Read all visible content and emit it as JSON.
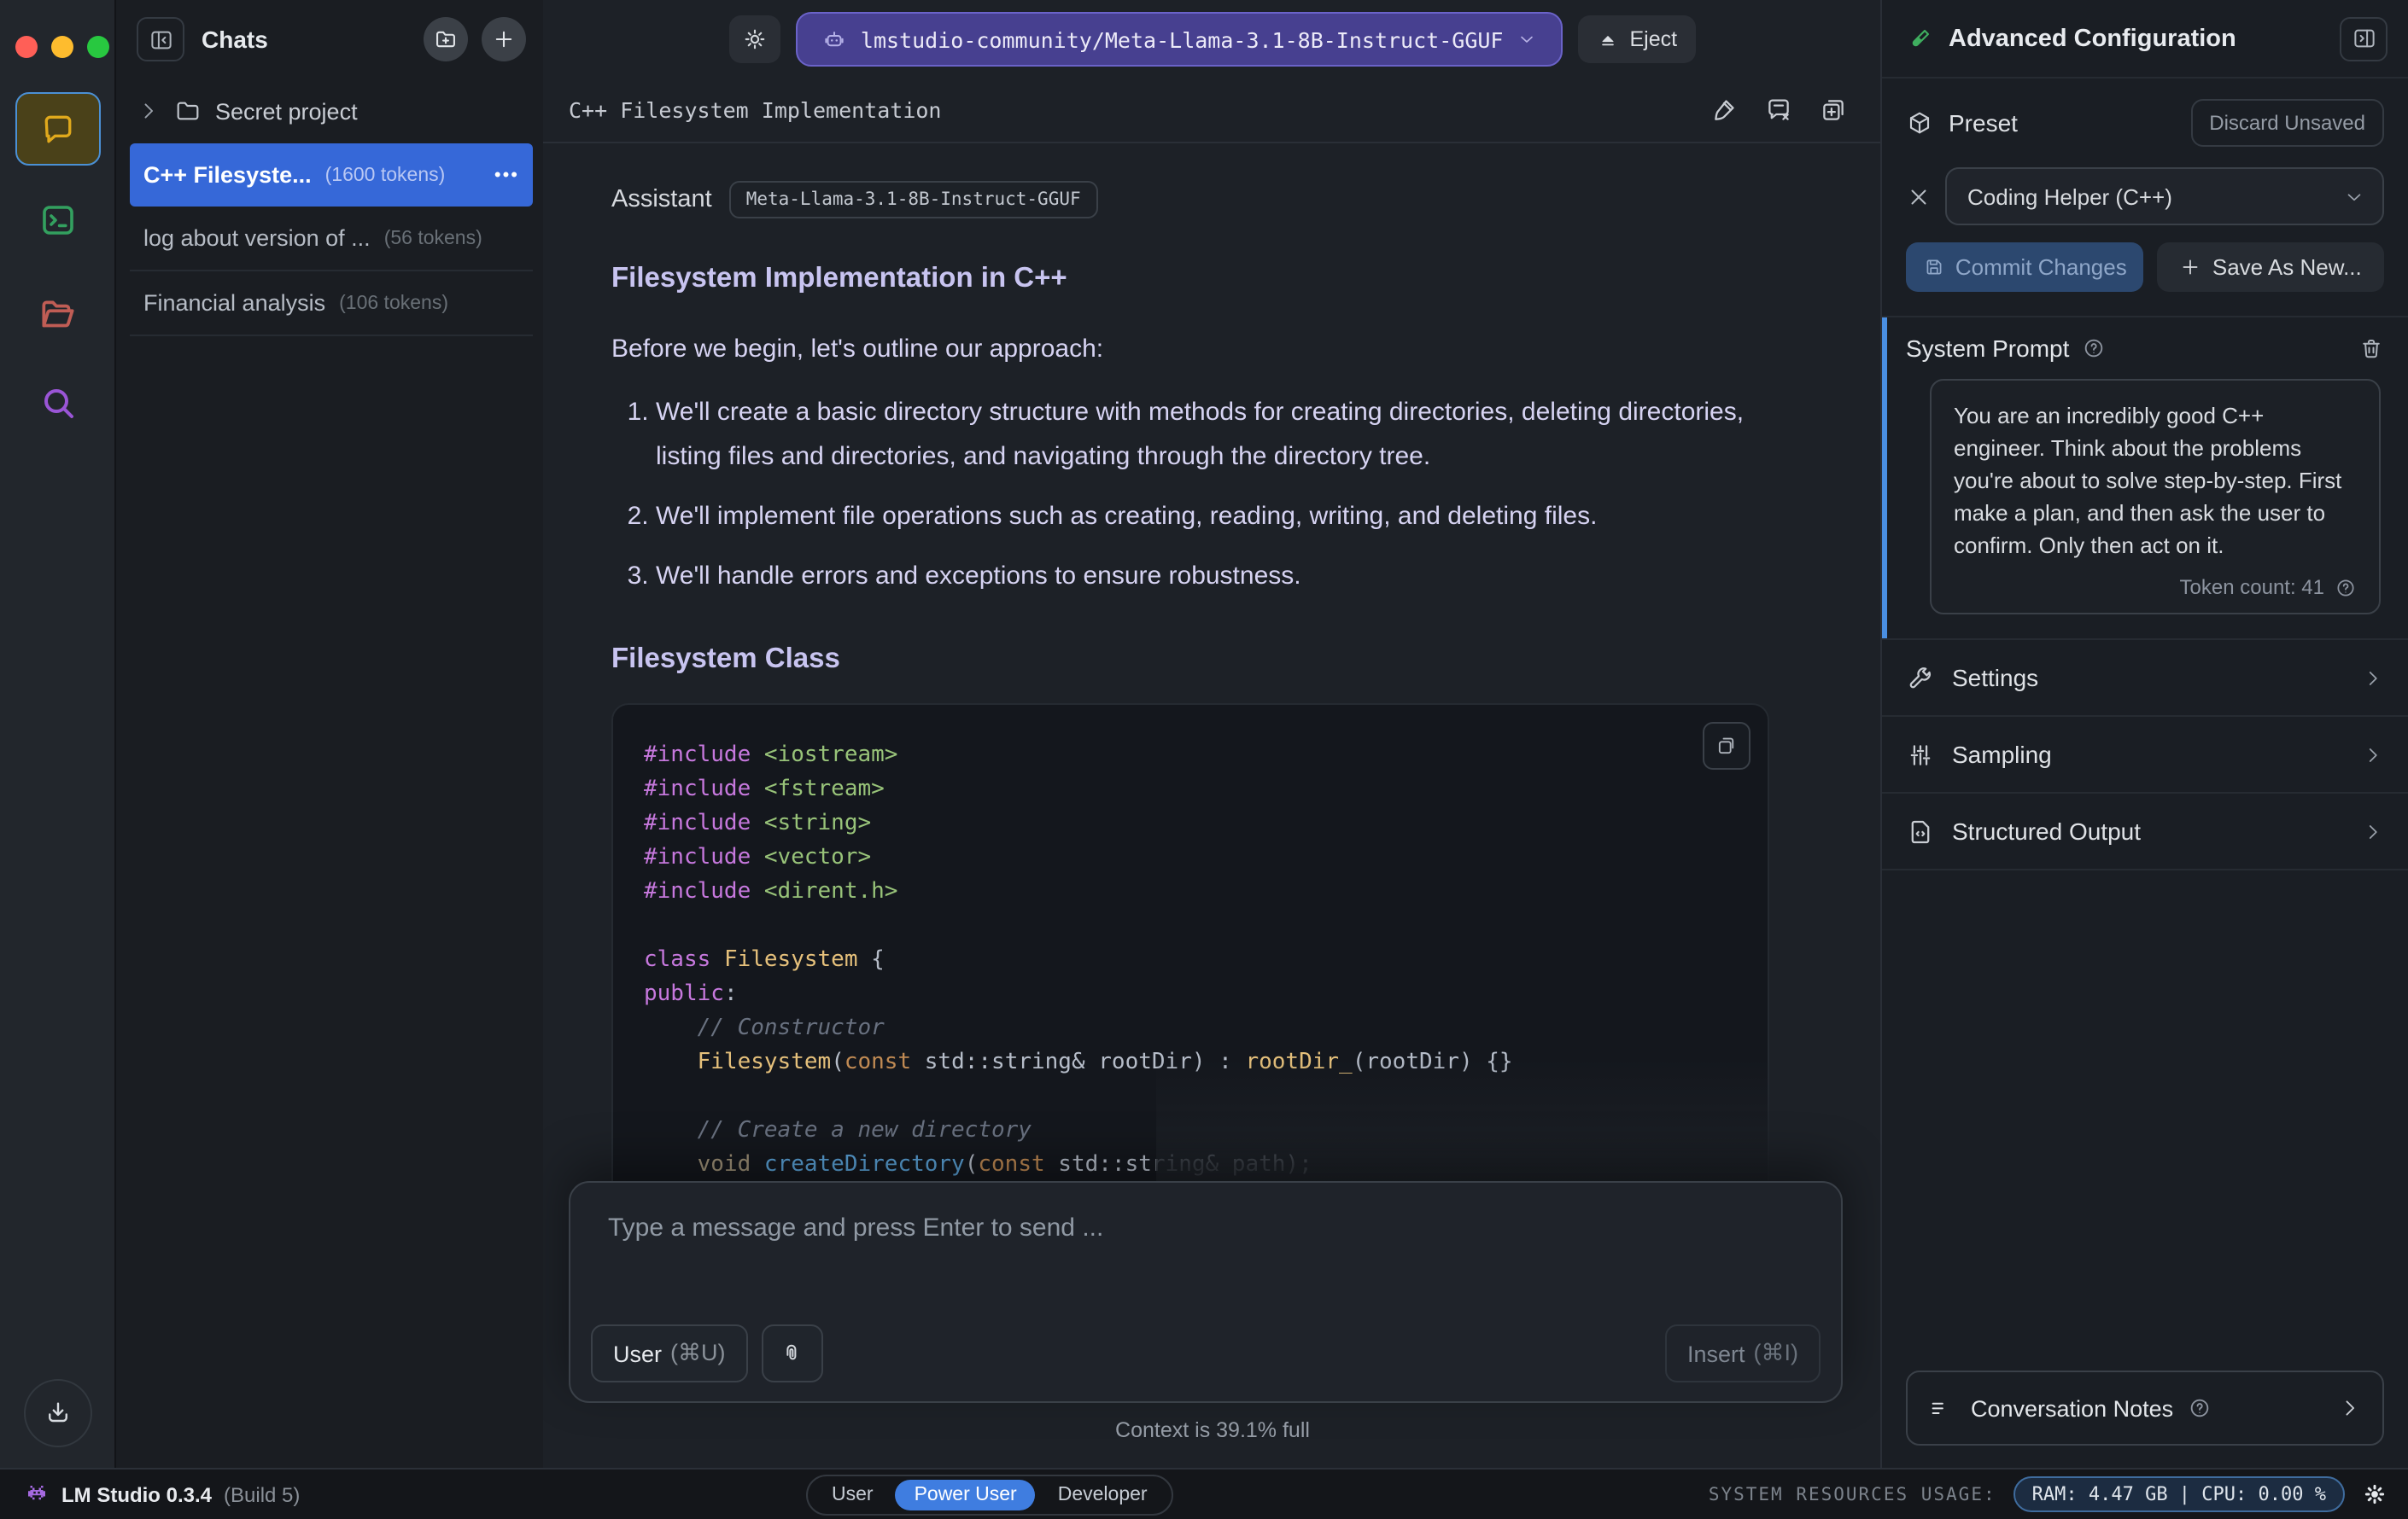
{
  "chats_panel": {
    "title": "Chats",
    "folder": {
      "name": "Secret project"
    },
    "items": [
      {
        "title": "C++ Filesyste...",
        "tokens": "(1600 tokens)",
        "selected": true,
        "menu": "•••"
      },
      {
        "title": "log about version of ...",
        "tokens": "(56 tokens)"
      },
      {
        "title": "Financial analysis",
        "tokens": "(106 tokens)"
      }
    ]
  },
  "topbar": {
    "model": "lmstudio-community/Meta-Llama-3.1-8B-Instruct-GGUF",
    "eject_label": "Eject"
  },
  "chat": {
    "title": "C++ Filesystem Implementation",
    "assistant_label": "Assistant",
    "model_badge": "Meta-Llama-3.1-8B-Instruct-GGUF",
    "heading1": "Filesystem Implementation in C++",
    "intro": "Before we begin, let's outline our approach:",
    "list": [
      "We'll create a basic directory structure with methods for creating directories, deleting directories, listing files and directories, and navigating through the directory tree.",
      "We'll implement file operations such as creating, reading, writing, and deleting files.",
      "We'll handle errors and exceptions to ensure robustness."
    ],
    "heading2": "Filesystem Class",
    "code": {
      "lines": [
        [
          [
            "kw",
            "#include"
          ],
          [
            "pl",
            " "
          ],
          [
            "str",
            "<iostream>"
          ]
        ],
        [
          [
            "kw",
            "#include"
          ],
          [
            "pl",
            " "
          ],
          [
            "str",
            "<fstream>"
          ]
        ],
        [
          [
            "kw",
            "#include"
          ],
          [
            "pl",
            " "
          ],
          [
            "str",
            "<string>"
          ]
        ],
        [
          [
            "kw",
            "#include"
          ],
          [
            "pl",
            " "
          ],
          [
            "str",
            "<vector>"
          ]
        ],
        [
          [
            "kw",
            "#include"
          ],
          [
            "pl",
            " "
          ],
          [
            "str",
            "<dirent.h>"
          ]
        ],
        [],
        [
          [
            "kw",
            "class"
          ],
          [
            "pl",
            " "
          ],
          [
            "type",
            "Filesystem"
          ],
          [
            "pl",
            " {"
          ]
        ],
        [
          [
            "kw",
            "public"
          ],
          [
            "pl",
            ":"
          ]
        ],
        [
          [
            "cm",
            "    // Constructor"
          ]
        ],
        [
          [
            "pl",
            "    "
          ],
          [
            "type",
            "Filesystem"
          ],
          [
            "pl",
            "("
          ],
          [
            "kw2",
            "const"
          ],
          [
            "pl",
            " std::string& rootDir) : "
          ],
          [
            "type",
            "rootDir_"
          ],
          [
            "pl",
            "(rootDir) {}"
          ]
        ],
        [],
        [
          [
            "cm",
            "    // Create a new directory"
          ]
        ],
        [
          [
            "pl",
            "    "
          ],
          [
            "mut",
            "void"
          ],
          [
            "pl",
            " "
          ],
          [
            "fn",
            "createDirectory"
          ],
          [
            "pl",
            "("
          ],
          [
            "kw2",
            "const"
          ],
          [
            "pl",
            " std::string& path);"
          ]
        ]
      ]
    }
  },
  "composer": {
    "placeholder": "Type a message and press Enter to send ...",
    "role_label": "User",
    "role_shortcut": "(⌘U)",
    "insert_label": "Insert",
    "insert_shortcut": "(⌘I)",
    "context_status": "Context is 39.1% full"
  },
  "advanced": {
    "title": "Advanced Configuration",
    "preset": {
      "label": "Preset",
      "discard_label": "Discard Unsaved",
      "value": "Coding Helper (C++)",
      "commit_label": "Commit Changes",
      "save_as_label": "Save As New..."
    },
    "system_prompt": {
      "label": "System Prompt",
      "text": "You are an incredibly good C++ engineer. Think about the problems you're about to solve step-by-step. First make a plan, and then ask the user to confirm. Only then act on it.",
      "token_count": "Token count: 41"
    },
    "sections": [
      "Settings",
      "Sampling",
      "Structured Output"
    ],
    "notes_label": "Conversation Notes"
  },
  "statusbar": {
    "app": "LM Studio 0.3.4",
    "build": "(Build 5)",
    "modes": [
      "User",
      "Power User",
      "Developer"
    ],
    "active_mode": "Power User",
    "resources_label": "SYSTEM RESOURCES USAGE:",
    "usage": "RAM: 4.47 GB  |  CPU: 0.00 %"
  },
  "colors": {
    "selected_chat_row": "#3668d8",
    "model_pill_bg": "#474090",
    "model_pill_border": "#6b63c9",
    "accent_blue": "#4a8fe2",
    "active_mode_bg": "#3f7de0",
    "rail_chat_icon": "#e0a91c",
    "rail_terminal_icon": "#33a05f",
    "rail_folder_icon": "#c05d55",
    "rail_search_icon": "#9a55d6",
    "traffic_red": "#ff5f57",
    "traffic_yellow": "#febc2e",
    "traffic_green": "#28c840",
    "code_keyword": "#c678dd",
    "code_string": "#98c379",
    "code_type": "#e5c07b",
    "code_function": "#5ba3d9",
    "code_comment": "#697180"
  }
}
